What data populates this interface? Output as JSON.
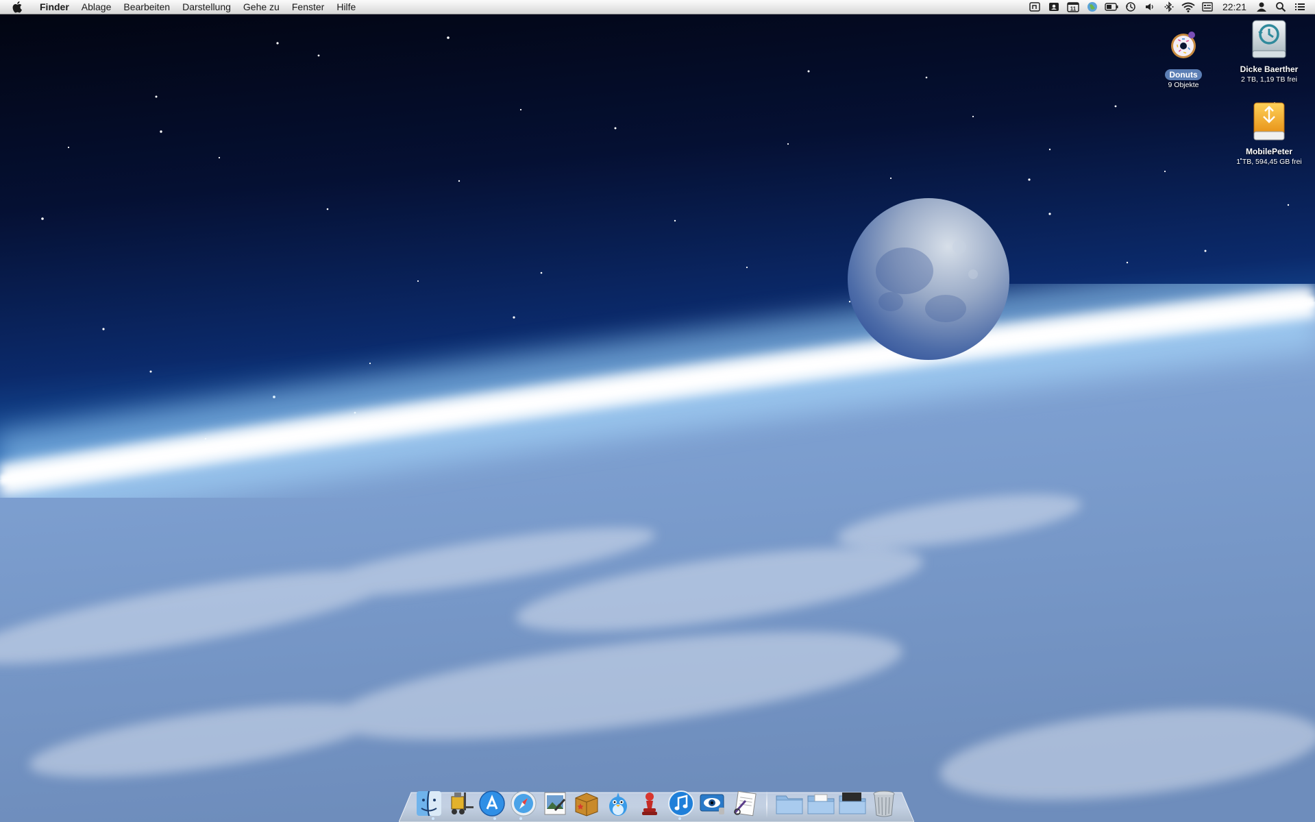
{
  "menubar": {
    "apple_icon": "apple-icon",
    "app_name": "Finder",
    "menus": [
      "Ablage",
      "Bearbeiten",
      "Darstellung",
      "Gehe zu",
      "Fenster",
      "Hilfe"
    ],
    "status_icons": [
      "script-menu-icon",
      "address-book-icon",
      "calendar-icon",
      "network-globe-icon",
      "battery-icon",
      "time-machine-icon",
      "volume-icon",
      "bluetooth-icon",
      "wifi-icon",
      "input-menu-icon"
    ],
    "calendar_day": "11",
    "clock": "22:21",
    "user_icon": "user-icon",
    "spotlight_icon": "spotlight-icon",
    "notifications_icon": "list-icon"
  },
  "desktop": {
    "icons": [
      {
        "name": "Donuts",
        "info": "9 Objekte",
        "icon": "donut-folder-icon",
        "selected": true
      },
      {
        "name": "Dicke Baerther",
        "info": "2 TB, 1,19 TB frei",
        "icon": "time-machine-drive-icon"
      },
      {
        "name": "MobilePeter",
        "info": "1 TB, 594,45 GB frei",
        "icon": "external-drive-icon"
      }
    ]
  },
  "dock": {
    "apps": [
      "finder-icon",
      "forklift-icon",
      "app-store-icon",
      "safari-icon",
      "preview-icon",
      "archive-box-icon",
      "bird-app-icon",
      "chess-pawn-icon",
      "itunes-icon",
      "eye-app-icon",
      "textedit-icon"
    ],
    "stacks": [
      "applications-folder-icon",
      "documents-folder-icon",
      "downloads-folder-icon"
    ],
    "trash": "trash-icon"
  },
  "colors": {
    "sky_top": "#03061a",
    "sky_mid": "#0d3b8c",
    "horizon_glow": "#e9f6ff",
    "earth": "#7f9cc4",
    "selection": "#5c7fb5"
  }
}
